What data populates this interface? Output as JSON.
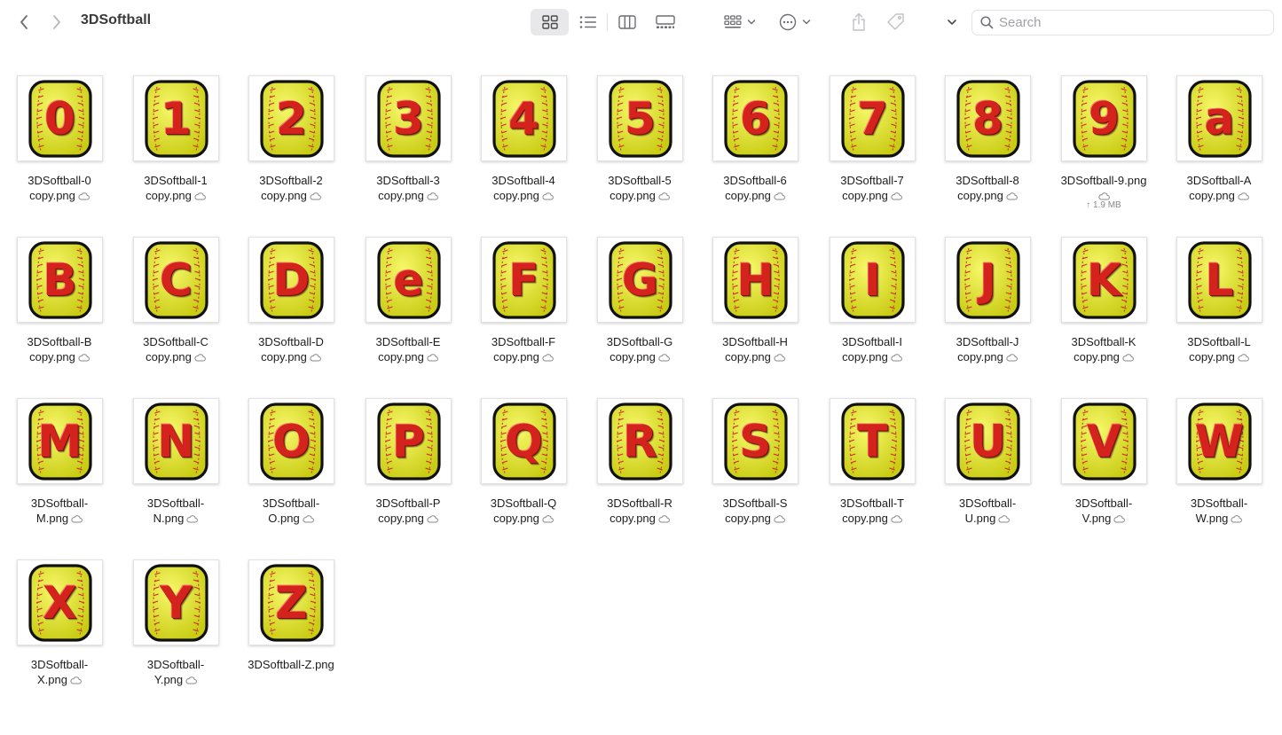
{
  "window": {
    "title": "3DSoftball"
  },
  "search": {
    "placeholder": "Search"
  },
  "toolbar": {
    "back_icon": "chevron-left-icon",
    "forward_icon": "chevron-right-icon",
    "views": [
      "icon-view",
      "list-view",
      "column-view",
      "gallery-view"
    ],
    "active_view": "icon-view"
  },
  "colors": {
    "tile_yellow": "#e6e82a",
    "letter_red": "#d4221c",
    "stitch_red": "#c7281e",
    "outline": "#111111"
  },
  "files": [
    {
      "glyph": "0",
      "line1": "3DSoftball-0",
      "line2": "copy.png",
      "cloud": true
    },
    {
      "glyph": "1",
      "line1": "3DSoftball-1",
      "line2": "copy.png",
      "cloud": true
    },
    {
      "glyph": "2",
      "line1": "3DSoftball-2",
      "line2": "copy.png",
      "cloud": true
    },
    {
      "glyph": "3",
      "line1": "3DSoftball-3",
      "line2": "copy.png",
      "cloud": true
    },
    {
      "glyph": "4",
      "line1": "3DSoftball-4",
      "line2": "copy.png",
      "cloud": true
    },
    {
      "glyph": "5",
      "line1": "3DSoftball-5",
      "line2": "copy.png",
      "cloud": true
    },
    {
      "glyph": "6",
      "line1": "3DSoftball-6",
      "line2": "copy.png",
      "cloud": true
    },
    {
      "glyph": "7",
      "line1": "3DSoftball-7",
      "line2": "copy.png",
      "cloud": true
    },
    {
      "glyph": "8",
      "line1": "3DSoftball-8",
      "line2": "copy.png",
      "cloud": true
    },
    {
      "glyph": "9",
      "line1": "3DSoftball-9.png",
      "line2": "",
      "cloud": true,
      "sub": "↑ 1.9 MB"
    },
    {
      "glyph": "a",
      "line1": "3DSoftball-A",
      "line2": "copy.png",
      "cloud": true
    },
    {
      "glyph": "B",
      "line1": "3DSoftball-B",
      "line2": "copy.png",
      "cloud": true
    },
    {
      "glyph": "C",
      "line1": "3DSoftball-C",
      "line2": "copy.png",
      "cloud": true
    },
    {
      "glyph": "D",
      "line1": "3DSoftball-D",
      "line2": "copy.png",
      "cloud": true
    },
    {
      "glyph": "e",
      "line1": "3DSoftball-E",
      "line2": "copy.png",
      "cloud": true
    },
    {
      "glyph": "F",
      "line1": "3DSoftball-F",
      "line2": "copy.png",
      "cloud": true
    },
    {
      "glyph": "G",
      "line1": "3DSoftball-G",
      "line2": "copy.png",
      "cloud": true
    },
    {
      "glyph": "H",
      "line1": "3DSoftball-H",
      "line2": "copy.png",
      "cloud": true
    },
    {
      "glyph": "I",
      "line1": "3DSoftball-I",
      "line2": "copy.png",
      "cloud": true
    },
    {
      "glyph": "J",
      "line1": "3DSoftball-J",
      "line2": "copy.png",
      "cloud": true
    },
    {
      "glyph": "K",
      "line1": "3DSoftball-K",
      "line2": "copy.png",
      "cloud": true
    },
    {
      "glyph": "L",
      "line1": "3DSoftball-L",
      "line2": "copy.png",
      "cloud": true
    },
    {
      "glyph": "M",
      "line1": "3DSoftball-",
      "line2": "M.png",
      "cloud": true
    },
    {
      "glyph": "N",
      "line1": "3DSoftball-",
      "line2": "N.png",
      "cloud": true
    },
    {
      "glyph": "O",
      "line1": "3DSoftball-",
      "line2": "O.png",
      "cloud": true
    },
    {
      "glyph": "P",
      "line1": "3DSoftball-P",
      "line2": "copy.png",
      "cloud": true
    },
    {
      "glyph": "Q",
      "line1": "3DSoftball-Q",
      "line2": "copy.png",
      "cloud": true
    },
    {
      "glyph": "R",
      "line1": "3DSoftball-R",
      "line2": "copy.png",
      "cloud": true
    },
    {
      "glyph": "S",
      "line1": "3DSoftball-S",
      "line2": "copy.png",
      "cloud": true
    },
    {
      "glyph": "T",
      "line1": "3DSoftball-T",
      "line2": "copy.png",
      "cloud": true
    },
    {
      "glyph": "U",
      "line1": "3DSoftball-",
      "line2": "U.png",
      "cloud": true
    },
    {
      "glyph": "V",
      "line1": "3DSoftball-",
      "line2": "V.png",
      "cloud": true
    },
    {
      "glyph": "W",
      "line1": "3DSoftball-",
      "line2": "W.png",
      "cloud": true
    },
    {
      "glyph": "X",
      "line1": "3DSoftball-",
      "line2": "X.png",
      "cloud": true
    },
    {
      "glyph": "Y",
      "line1": "3DSoftball-",
      "line2": "Y.png",
      "cloud": true
    },
    {
      "glyph": "Z",
      "line1": "3DSoftball-Z.png",
      "line2": "",
      "cloud": false
    }
  ]
}
